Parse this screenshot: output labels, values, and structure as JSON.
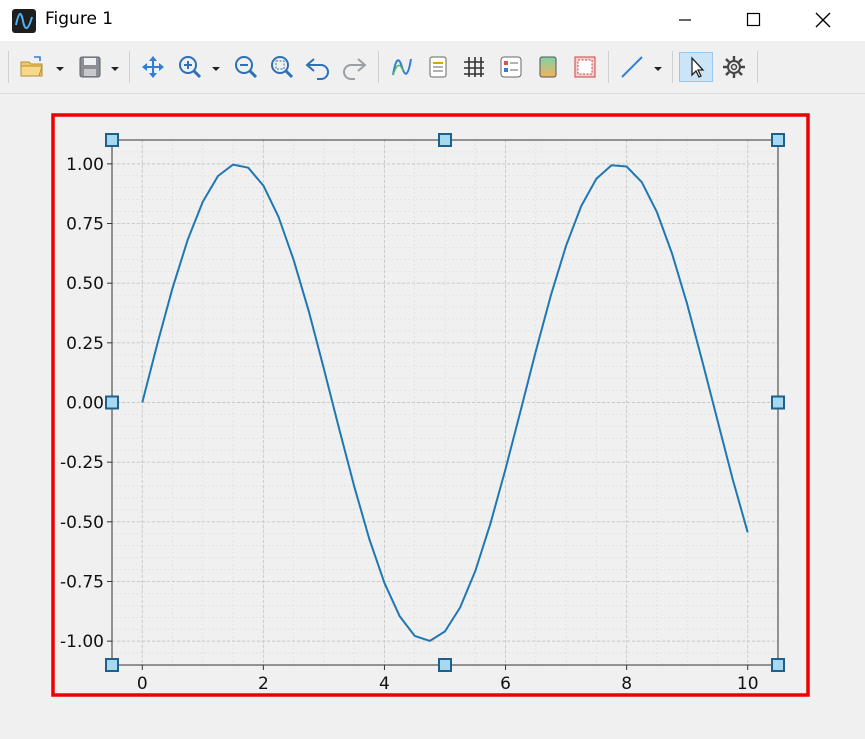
{
  "window": {
    "title": "Figure 1",
    "minimize_glyph": "—",
    "maximize_glyph": "☐",
    "close_glyph": "✕"
  },
  "toolbar": {
    "items": [
      {
        "name": "open-icon"
      },
      {
        "name": "save-icon"
      },
      {
        "name": "pan-icon"
      },
      {
        "name": "zoom-in-icon"
      },
      {
        "name": "zoom-out-icon"
      },
      {
        "name": "zoom-fit-icon"
      },
      {
        "name": "undo-icon"
      },
      {
        "name": "redo-icon"
      },
      {
        "name": "plot-style-icon"
      },
      {
        "name": "legend-icon"
      },
      {
        "name": "grid-icon"
      },
      {
        "name": "properties-icon"
      },
      {
        "name": "colormap-icon"
      },
      {
        "name": "frame-icon"
      },
      {
        "name": "line-tool-icon"
      },
      {
        "name": "select-pointer-icon"
      },
      {
        "name": "settings-gear-icon"
      }
    ]
  },
  "colors": {
    "line": "#1f77b4",
    "selection": "#ee0000",
    "handle_fill": "#a6d8f0",
    "handle_stroke": "#1f5f8a",
    "grid": "#dcdcdc"
  },
  "chart_data": {
    "type": "line",
    "title": "",
    "xlabel": "",
    "ylabel": "",
    "xlim": [
      -0.5,
      10.5
    ],
    "ylim": [
      -1.1,
      1.1
    ],
    "xticks": [
      0,
      2,
      4,
      6,
      8,
      10
    ],
    "xtick_labels": [
      "0",
      "2",
      "4",
      "6",
      "8",
      "10"
    ],
    "yticks": [
      1.0,
      0.75,
      0.5,
      0.25,
      0.0,
      -0.25,
      -0.5,
      -0.75,
      -1.0
    ],
    "ytick_labels": [
      "1.00",
      "0.75",
      "0.50",
      "0.25",
      "0.00",
      "-0.25",
      "-0.50",
      "-0.75",
      "-1.00"
    ],
    "grid": true,
    "minor_grid": true,
    "series": [
      {
        "x": [
          0,
          0.25,
          0.5,
          0.75,
          1.0,
          1.25,
          1.5,
          1.75,
          2.0,
          2.25,
          2.5,
          2.75,
          3.0,
          3.25,
          3.5,
          3.75,
          4.0,
          4.25,
          4.5,
          4.75,
          5.0,
          5.25,
          5.5,
          5.75,
          6.0,
          6.25,
          6.5,
          6.75,
          7.0,
          7.25,
          7.5,
          7.75,
          8.0,
          8.25,
          8.5,
          8.75,
          9.0,
          9.25,
          9.5,
          9.75,
          10.0
        ],
        "y": [
          0.0,
          0.247,
          0.479,
          0.682,
          0.841,
          0.949,
          0.997,
          0.984,
          0.909,
          0.778,
          0.598,
          0.382,
          0.141,
          -0.108,
          -0.351,
          -0.572,
          -0.757,
          -0.895,
          -0.978,
          -0.999,
          -0.959,
          -0.859,
          -0.706,
          -0.508,
          -0.279,
          -0.033,
          0.215,
          0.451,
          0.657,
          0.823,
          0.938,
          0.994,
          0.989,
          0.923,
          0.798,
          0.625,
          0.412,
          0.173,
          -0.075,
          -0.32,
          -0.544
        ]
      }
    ]
  }
}
